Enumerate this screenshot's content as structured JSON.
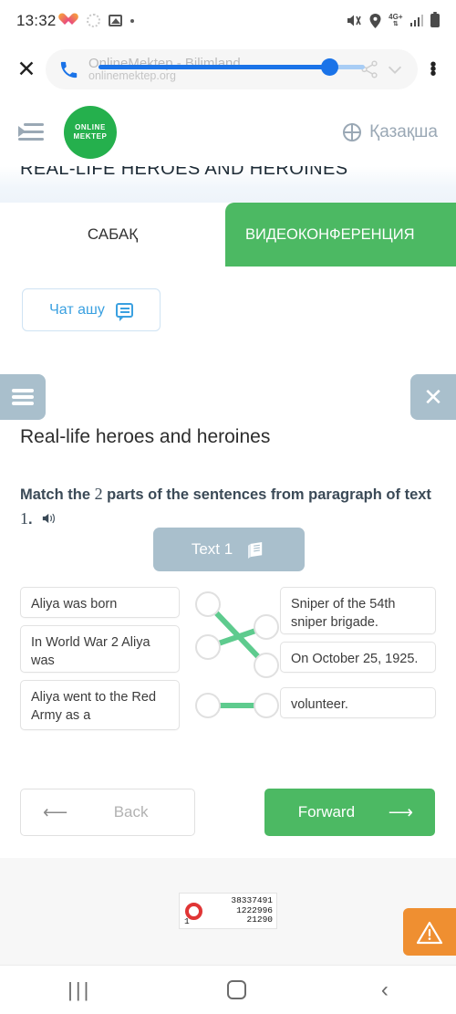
{
  "status_bar": {
    "time": "13:32",
    "network_label": "4G+",
    "left_icons": [
      "heart-icon",
      "gear-icon",
      "photo-icon",
      "dot-icon"
    ],
    "right_icons": [
      "mute-icon",
      "location-pin-icon",
      "network-4g-icon",
      "signal-bars-icon",
      "battery-icon"
    ]
  },
  "browser_bar": {
    "close_label": "✕",
    "page_title": "OnlineMektep - Bilimland",
    "page_url": "onlinemektep.org",
    "call_icon": "phone-icon",
    "share_icon": "share-icon",
    "chevron_icon": "chevron-down-icon",
    "menu_icon": "kebab-menu-icon",
    "volume_percent": 84
  },
  "site_header": {
    "menu_icon": "hamburger-collapse-icon",
    "logo_line1": "ONLINE",
    "logo_line2": "MEKTEP",
    "language_label": "Қазақша",
    "globe_icon": "globe-icon",
    "brand_green": "#25b04d"
  },
  "banner": {
    "title": "REAL-LIFE HEROES AND HEROINES"
  },
  "tabs": [
    {
      "label": "САБАҚ",
      "active": false
    },
    {
      "label": "ВИДЕОКОНФЕРЕНЦИЯ",
      "active": true
    }
  ],
  "chat_button": {
    "label": "Чат ашу",
    "icon": "chat-bubble-icon"
  },
  "exercise": {
    "menu_icon": "hamburger-icon",
    "close_label": "✕",
    "title": "Real-life heroes and heroines",
    "instruction_pre": "Match the ",
    "instruction_num1": "2",
    "instruction_mid": " parts of the sentences from paragraph of text ",
    "instruction_num2": "1",
    "instruction_post": ".",
    "speaker_icon": "speaker-icon",
    "text_button": {
      "label": "Text 1",
      "icon": "book-icon"
    },
    "left_items": [
      "Aliya was born",
      "In World War 2 Aliya was",
      "Aliya went to the Red Army as a"
    ],
    "right_items": [
      "Sniper of the 54th sniper brigade.",
      "On October 25, 1925.",
      "volunteer."
    ],
    "connections": [
      {
        "from": 0,
        "to": 1
      },
      {
        "from": 1,
        "to": 0
      },
      {
        "from": 2,
        "to": 2
      }
    ],
    "connection_color": "#5ecb8e"
  },
  "nav_buttons": {
    "back_label": "Back",
    "back_icon": "arrow-left-icon",
    "forward_label": "Forward",
    "forward_icon": "arrow-right-icon",
    "forward_color": "#4cb963"
  },
  "footer": {
    "counter": {
      "value_1": "38337491",
      "value_2": "1222996",
      "value_3": "21290",
      "rank": "1",
      "ring_icon": "liveinternet-ring-icon"
    },
    "warning_icon": "warning-triangle-icon",
    "warning_color": "#ef8f31"
  },
  "android_nav": {
    "recent_icon": "recent-apps-icon",
    "home_icon": "home-icon",
    "back_icon": "back-chevron-icon"
  }
}
